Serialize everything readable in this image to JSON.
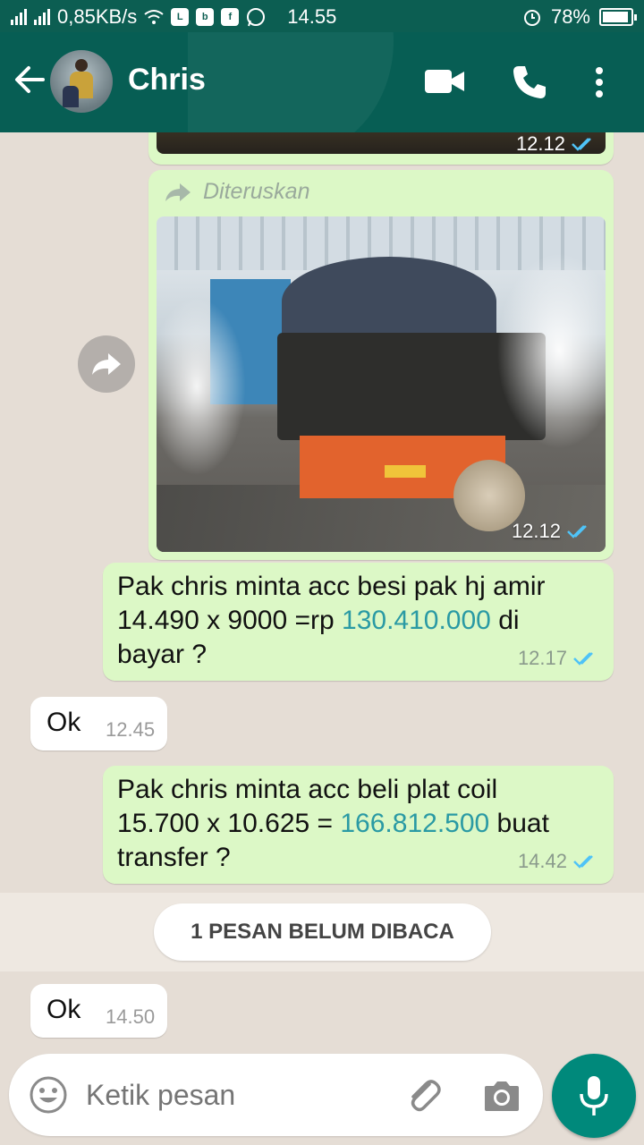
{
  "status_bar": {
    "speed": "0,85KB/s",
    "time": "14.55",
    "battery": "78%",
    "icons": [
      "signal-icon",
      "signal-icon",
      "wifi-icon",
      "line-icon",
      "bbm-icon",
      "facebook-icon",
      "whatsapp-icon",
      "alarm-icon",
      "battery-icon"
    ]
  },
  "header": {
    "contact_name": "Chris",
    "icons": [
      "back-arrow-icon",
      "avatar",
      "video-call-icon",
      "phone-call-icon",
      "menu-icon"
    ]
  },
  "messages": {
    "photo_prev": {
      "time": "12.12"
    },
    "forwarded": {
      "label": "Diteruskan",
      "time": "12.12"
    },
    "m1": {
      "line1": "Pak chris minta acc  besi pak hj amir",
      "line2_pre": "14.490 x 9000 =rp ",
      "line2_link": "130.410.000",
      "line2_post": " di",
      "line3": "bayar ?",
      "time": "12.17"
    },
    "m2": {
      "text": "Ok",
      "time": "12.45"
    },
    "m3": {
      "line1": "Pak chris minta acc beli plat coil",
      "line2_pre": "15.700 x 10.625  = ",
      "line2_link": "166.812.500",
      "line2_post": " buat",
      "line3": "transfer ?",
      "time": "14.42"
    },
    "unread_label": "1 PESAN BELUM DIBACA",
    "m4": {
      "text": "Ok",
      "time": "14.50"
    }
  },
  "composer": {
    "placeholder": "Ketik pesan"
  },
  "colors": {
    "header": "#075e54",
    "outgoing": "#dcf8c6",
    "link": "#2a9aa4",
    "read_ticks": "#4fc3f7",
    "mic": "#00897b"
  }
}
